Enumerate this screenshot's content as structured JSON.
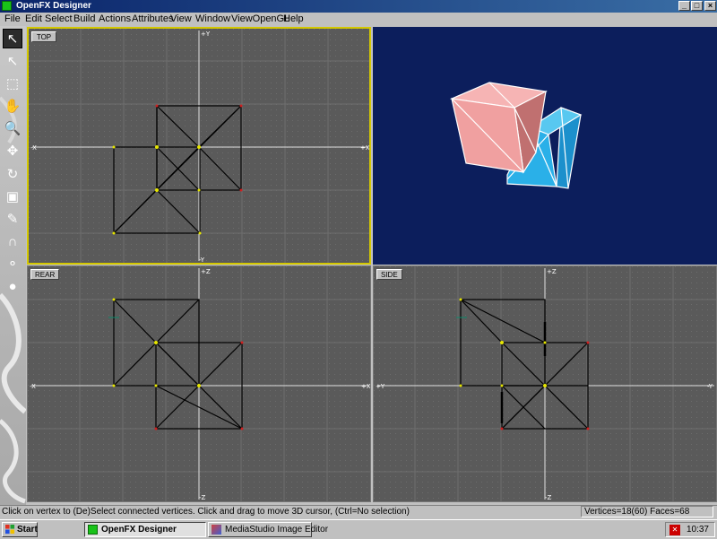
{
  "window": {
    "title": "OpenFX Designer",
    "controls": {
      "minimize": "_",
      "maximize": "□",
      "close": "×"
    }
  },
  "menu": [
    "File",
    "Edit",
    "Select",
    "Build",
    "Actions",
    "Attributes",
    "View",
    "Window",
    "ViewOpenGL",
    "Help"
  ],
  "toolbox": {
    "tools": [
      {
        "icon": "pointer-arrow-icon",
        "glyph": "↖",
        "active": true
      },
      {
        "icon": "select-arrow-icon",
        "glyph": "↖",
        "active": false
      },
      {
        "icon": "box-select-icon",
        "glyph": "⬚",
        "active": false
      },
      {
        "icon": "hand-pan-icon",
        "glyph": "✋",
        "active": false
      },
      {
        "icon": "zoom-magnifier-icon",
        "glyph": "🔍",
        "active": false
      },
      {
        "icon": "move-arrows-icon",
        "glyph": "✥",
        "active": false
      },
      {
        "icon": "rotate-icon",
        "glyph": "↻",
        "active": false
      },
      {
        "icon": "scale-frame-icon",
        "glyph": "▣",
        "active": false
      },
      {
        "icon": "pen-icon",
        "glyph": "✎",
        "active": false
      },
      {
        "icon": "magnet-icon",
        "glyph": "∩",
        "active": false
      },
      {
        "icon": "spheres-icon",
        "glyph": "⚬",
        "active": false
      },
      {
        "icon": "render-ball-icon",
        "glyph": "●",
        "active": false
      }
    ]
  },
  "viewports": {
    "top": {
      "label": "TOP",
      "axis_top": "+Y",
      "axis_bottom": "-Y",
      "axis_left": "-X",
      "axis_right": "+X"
    },
    "rear": {
      "label": "REAR",
      "axis_top": "+Z",
      "axis_bottom": "-Z",
      "axis_left": "-X",
      "axis_right": "+X"
    },
    "side": {
      "label": "SIDE",
      "axis_top": "+Z",
      "axis_bottom": "-Z",
      "axis_left": "+Y",
      "axis_right": "-Y"
    },
    "perspective": {
      "cube_colors": {
        "pink": "#f0a0a0",
        "blue": "#2ab0e8"
      }
    }
  },
  "status": {
    "message": "Click on vertex to (De)Select connected vertices. Click and drag to move 3D cursor, (Ctrl=No selection)",
    "counts": "Vertices=18(60) Faces=68"
  },
  "taskbar": {
    "start": "Start",
    "tasks": [
      {
        "label": "OpenFX Designer",
        "pressed": true
      },
      {
        "label": "MediaStudio Image Editor",
        "pressed": false
      }
    ],
    "clock": "10:37"
  }
}
